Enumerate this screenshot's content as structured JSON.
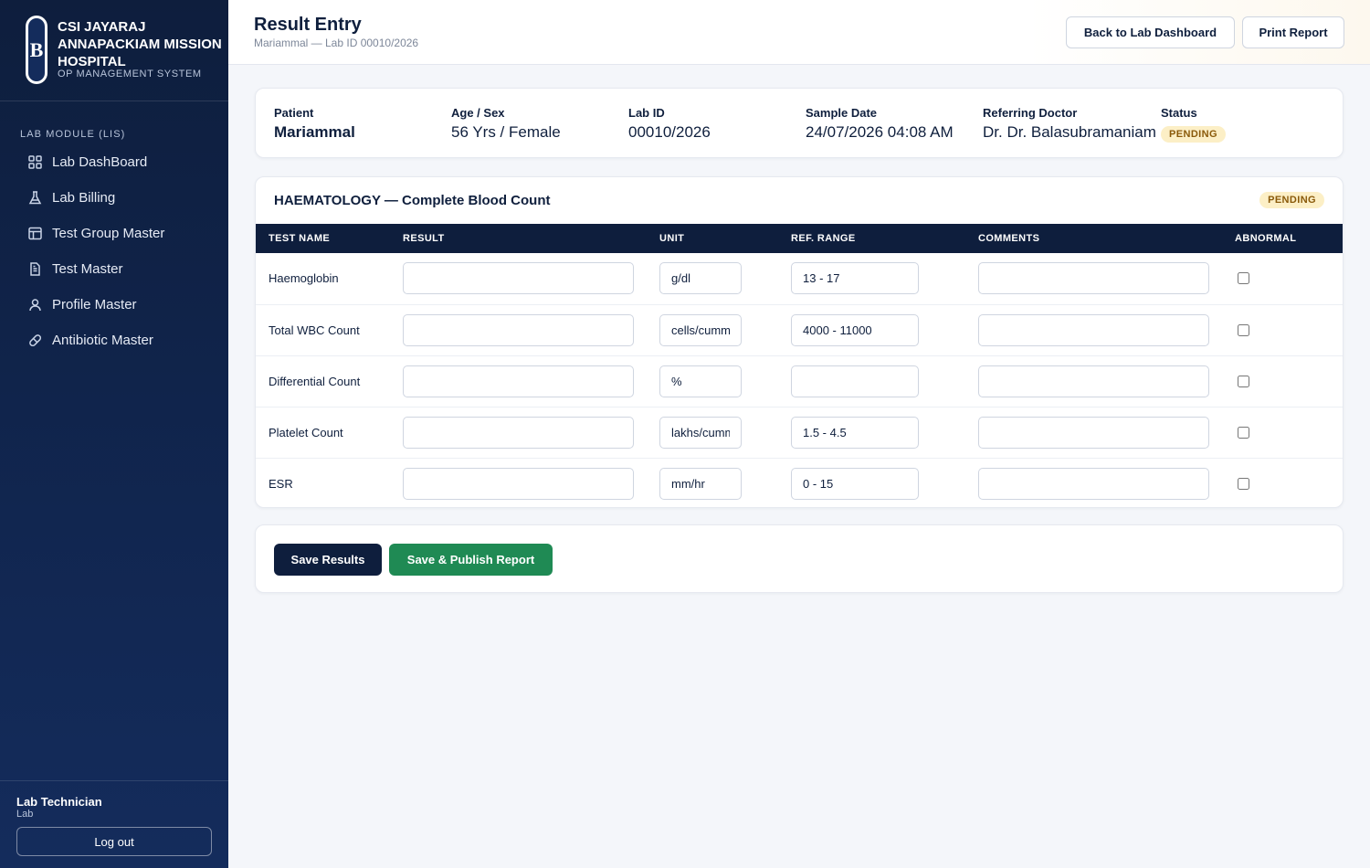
{
  "brand": {
    "logo_letter": "B",
    "name": "CSI JAYARAJ ANNAPACKIAM MISSION HOSPITAL",
    "subtitle": "OP MANAGEMENT SYSTEM"
  },
  "sidebar": {
    "section_label": "LAB MODULE (LIS)",
    "items": [
      {
        "label": "Lab DashBoard",
        "icon": "grid-icon"
      },
      {
        "label": "Lab Billing",
        "icon": "flask-icon"
      },
      {
        "label": "Test Group Master",
        "icon": "layout-icon"
      },
      {
        "label": "Test Master",
        "icon": "file-text-icon"
      },
      {
        "label": "Profile Master",
        "icon": "user-icon"
      },
      {
        "label": "Antibiotic Master",
        "icon": "pill-icon"
      }
    ],
    "user": {
      "name": "Lab Technician",
      "role": "Lab"
    },
    "logout_label": "Log out"
  },
  "header": {
    "title": "Result Entry",
    "subtitle": "Mariammal — Lab ID 00010/2026",
    "back_label": "Back to Lab Dashboard",
    "print_label": "Print Report"
  },
  "patient_info": {
    "patient_label": "Patient",
    "patient_value": "Mariammal",
    "age_label": "Age / Sex",
    "age_value": "56 Yrs / Female",
    "labid_label": "Lab ID",
    "labid_value": "00010/2026",
    "date_label": "Sample Date",
    "date_value": "24/07/2026 04:08 AM",
    "doctor_label": "Referring Doctor",
    "doctor_value": "Dr. Dr. Balasubramaniam",
    "status_label": "Status",
    "status_value": "PENDING"
  },
  "test_group": {
    "title": "HAEMATOLOGY — Complete Blood Count",
    "status": "PENDING",
    "columns": [
      "TEST NAME",
      "RESULT",
      "UNIT",
      "REF. RANGE",
      "COMMENTS",
      "ABNORMAL"
    ],
    "rows": [
      {
        "name": "Haemoglobin",
        "result": "",
        "unit": "g/dl",
        "ref_range": "13 - 17",
        "comments": "",
        "abnormal": false
      },
      {
        "name": "Total WBC Count",
        "result": "",
        "unit": "cells/cumm",
        "ref_range": "4000 - 11000",
        "comments": "",
        "abnormal": false
      },
      {
        "name": "Differential Count",
        "result": "",
        "unit": "%",
        "ref_range": "",
        "comments": "",
        "abnormal": false
      },
      {
        "name": "Platelet Count",
        "result": "",
        "unit": "lakhs/cumm",
        "ref_range": "1.5 - 4.5",
        "comments": "",
        "abnormal": false
      },
      {
        "name": "ESR",
        "result": "",
        "unit": "mm/hr",
        "ref_range": "0 - 15",
        "comments": "",
        "abnormal": false
      }
    ]
  },
  "actions": {
    "save_label": "Save Results",
    "publish_label": "Save & Publish Report"
  },
  "colors": {
    "sidebar_bg": "#0e1e3d",
    "accent_navy": "#0e1e3d",
    "publish_green": "#1f8a54",
    "pending_badge_bg": "#fcefc6",
    "pending_badge_text": "#8a5a0a"
  }
}
